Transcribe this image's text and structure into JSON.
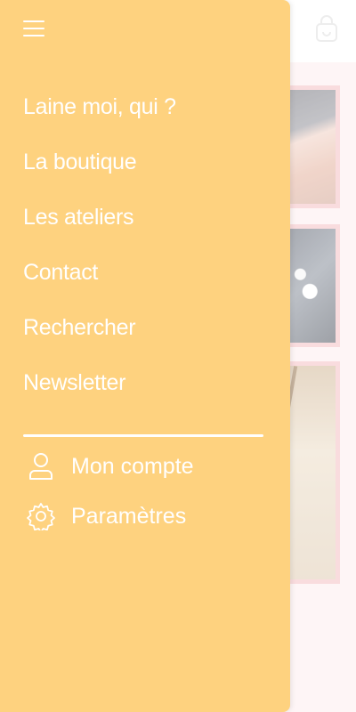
{
  "drawer": {
    "menu_icon": "hamburger-menu-icon",
    "nav_items": [
      {
        "label": "Laine moi, qui ?"
      },
      {
        "label": "La boutique"
      },
      {
        "label": "Les ateliers"
      },
      {
        "label": "Contact"
      },
      {
        "label": "Rechercher"
      },
      {
        "label": "Newsletter"
      }
    ],
    "account": {
      "label": "Mon compte",
      "icon": "user-icon"
    },
    "settings": {
      "label": "Paramètres",
      "icon": "gear-icon"
    }
  },
  "header": {
    "cart_icon": "shopping-bag-icon"
  },
  "colors": {
    "drawer_background": "#fed27f",
    "drawer_text": "#ffffff",
    "page_background": "#fdf0f1",
    "card_border": "#f6c9cc"
  }
}
